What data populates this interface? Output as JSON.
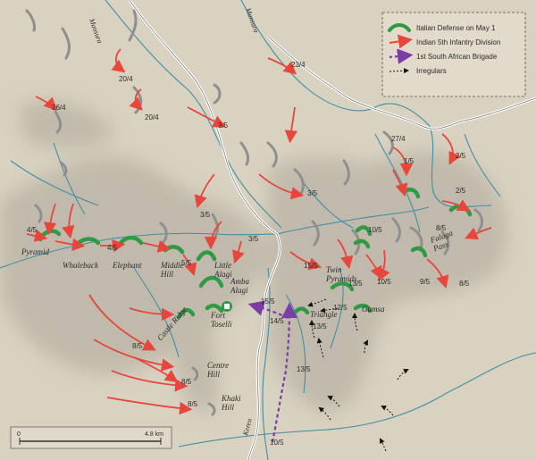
{
  "legend": {
    "italian_defense": "Italian Defense on May 1",
    "indian_division": "Indian 5th Infantry Division",
    "south_african": "1st South African Brigade",
    "irregulars": "Irregulars"
  },
  "colors": {
    "background": "#d9d2c1",
    "italian": "#2e9a44",
    "indian": "#e8453c",
    "south_african": "#7a3ea6",
    "river": "#3f8fa6",
    "road": "#ffffff",
    "ridge": "#8f8f8f"
  },
  "rivers": [
    "Mansura",
    "Mansura",
    "Keren"
  ],
  "places": {
    "pyramid": "Pyramid",
    "whaleback": "Whaleback",
    "elephant": "Elephant",
    "middle_hill": "Middle Hill",
    "little_alagi": "Little Alagi",
    "amba_alagi": "Amba Alagi",
    "fort_toselli": "Fort Toselli",
    "castle_ridge": "Castle Ridge",
    "centre_hill": "Centre Hill",
    "khaki_hill": "Khaki Hill",
    "twin_pyramids": "Twin Pyramids",
    "triangle": "Triangle",
    "gumsa": "Gumsa",
    "falaga_pass": "Falaga Pass"
  },
  "dates": [
    "20/4",
    "23/4",
    "26/4",
    "20/4",
    "3/5",
    "27/4",
    "2/5",
    "1/5",
    "2/5",
    "4/5",
    "4/5",
    "5/5",
    "3/5",
    "3/5",
    "3/5",
    "10/5",
    "15/5",
    "8/5",
    "10/5",
    "9/5",
    "8/5",
    "15/5",
    "13/5",
    "12/5",
    "14/5",
    "13/5",
    "13/5",
    "8/5",
    "8/5",
    "8/5",
    "10/5"
  ],
  "scale": {
    "start": "0",
    "end": "4.8 km"
  }
}
